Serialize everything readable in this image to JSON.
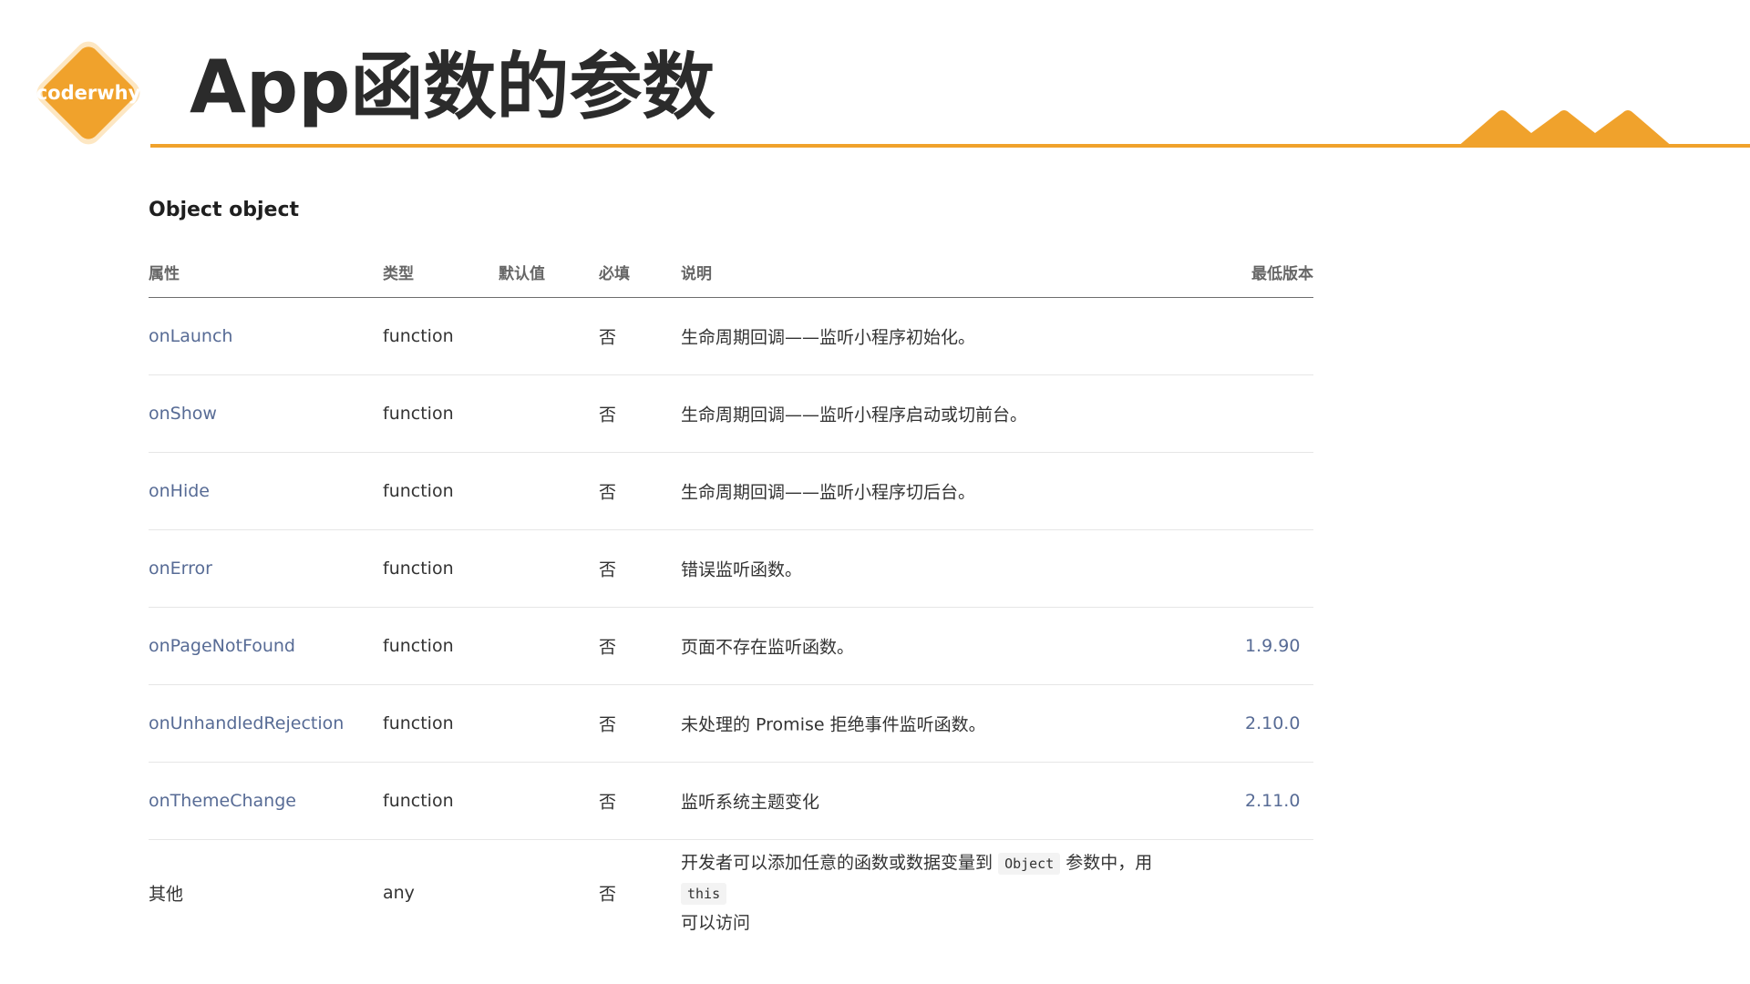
{
  "brand": {
    "logo_text": "coderwhy",
    "accent_color": "#f0a22c"
  },
  "page": {
    "title": "App函数的参数"
  },
  "section": {
    "heading": "Object object"
  },
  "table": {
    "headers": {
      "property": "属性",
      "type": "类型",
      "default": "默认值",
      "required": "必填",
      "description": "说明",
      "min_version": "最低版本"
    },
    "rows": [
      {
        "property": "onLaunch",
        "type": "function",
        "default": "",
        "required": "否",
        "description": "生命周期回调——监听小程序初始化。",
        "min_version": ""
      },
      {
        "property": "onShow",
        "type": "function",
        "default": "",
        "required": "否",
        "description": "生命周期回调——监听小程序启动或切前台。",
        "min_version": ""
      },
      {
        "property": "onHide",
        "type": "function",
        "default": "",
        "required": "否",
        "description": "生命周期回调——监听小程序切后台。",
        "min_version": ""
      },
      {
        "property": "onError",
        "type": "function",
        "default": "",
        "required": "否",
        "description": "错误监听函数。",
        "min_version": ""
      },
      {
        "property": "onPageNotFound",
        "type": "function",
        "default": "",
        "required": "否",
        "description": "页面不存在监听函数。",
        "min_version": "1.9.90"
      },
      {
        "property": "onUnhandledRejection",
        "type": "function",
        "default": "",
        "required": "否",
        "description": "未处理的 Promise 拒绝事件监听函数。",
        "min_version": "2.10.0"
      },
      {
        "property": "onThemeChange",
        "type": "function",
        "default": "",
        "required": "否",
        "description": "监听系统主题变化",
        "min_version": "2.11.0"
      },
      {
        "property": "其他",
        "type": "any",
        "default": "",
        "required": "否",
        "description_parts": {
          "part1": "开发者可以添加任意的函数或数据变量到",
          "code1": "Object",
          "part2": "参数中，用",
          "code2": "this",
          "part3": "可以访问"
        },
        "min_version": ""
      }
    ]
  }
}
